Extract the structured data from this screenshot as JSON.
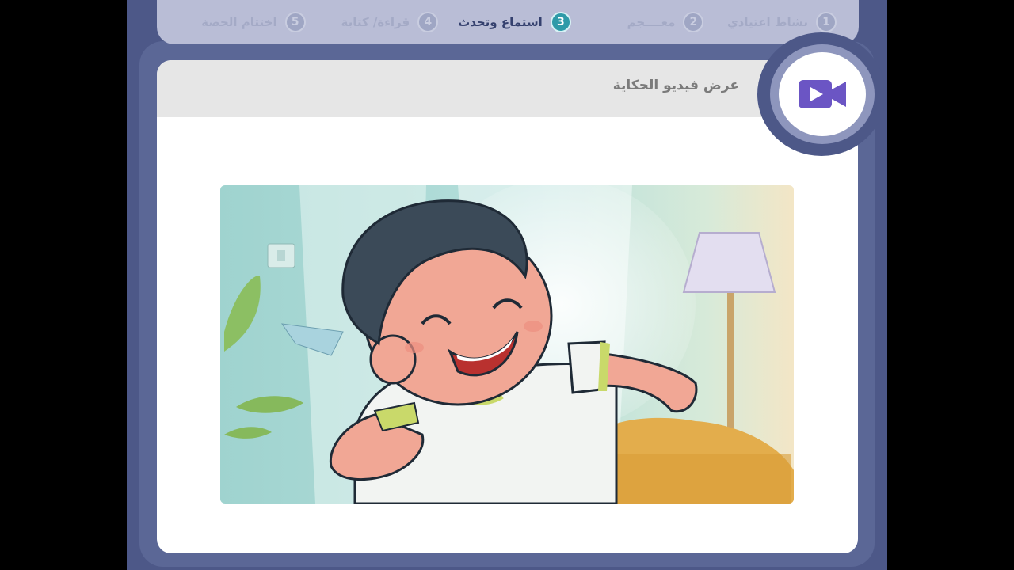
{
  "steps": [
    {
      "num": "1",
      "label": "نشاط اعتيادي"
    },
    {
      "num": "2",
      "label": "معــــجم"
    },
    {
      "num": "3",
      "label": "استماع وتحدث",
      "active": true
    },
    {
      "num": "4",
      "label": "قراءة/ كتابة"
    },
    {
      "num": "5",
      "label": "اختتام الحصة"
    }
  ],
  "card": {
    "title": "عرض فيديو الحكاية"
  },
  "icons": {
    "video": "video-camera-icon"
  },
  "colors": {
    "frame": "#4d5888",
    "active_step": "#2e9aa8",
    "video_icon": "#6b55c4"
  }
}
